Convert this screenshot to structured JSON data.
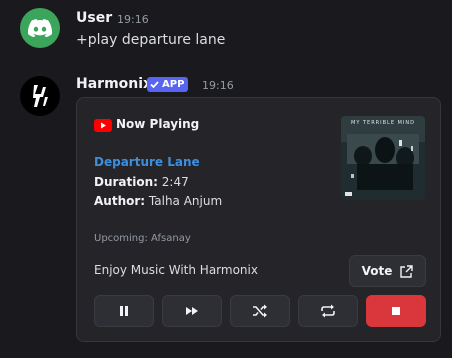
{
  "messages": [
    {
      "username": "User",
      "time": "19:16",
      "text": "+play departure lane"
    },
    {
      "username": "Harmonix",
      "badge": "APP",
      "time": "19:16"
    }
  ],
  "embed": {
    "header": "Now Playing",
    "song_title": "Departure Lane",
    "duration_label": "Duration:",
    "duration": "2:47",
    "author_label": "Author:",
    "author": "Talha Anjum",
    "thumbnail_caption": "MY TERRIBLE MIND",
    "upcoming": "Upcoming: Afsanay",
    "footer": "Enjoy Music With Harmonix",
    "vote_label": "Vote"
  },
  "controls": [
    "pause",
    "skip",
    "shuffle",
    "loop",
    "stop"
  ],
  "colors": {
    "background": "#1a1a1e",
    "embed_bg": "#242429",
    "link": "#3d8fde",
    "badge": "#5865f2",
    "stop_button": "#da373c",
    "user_avatar": "#3ba55c"
  }
}
